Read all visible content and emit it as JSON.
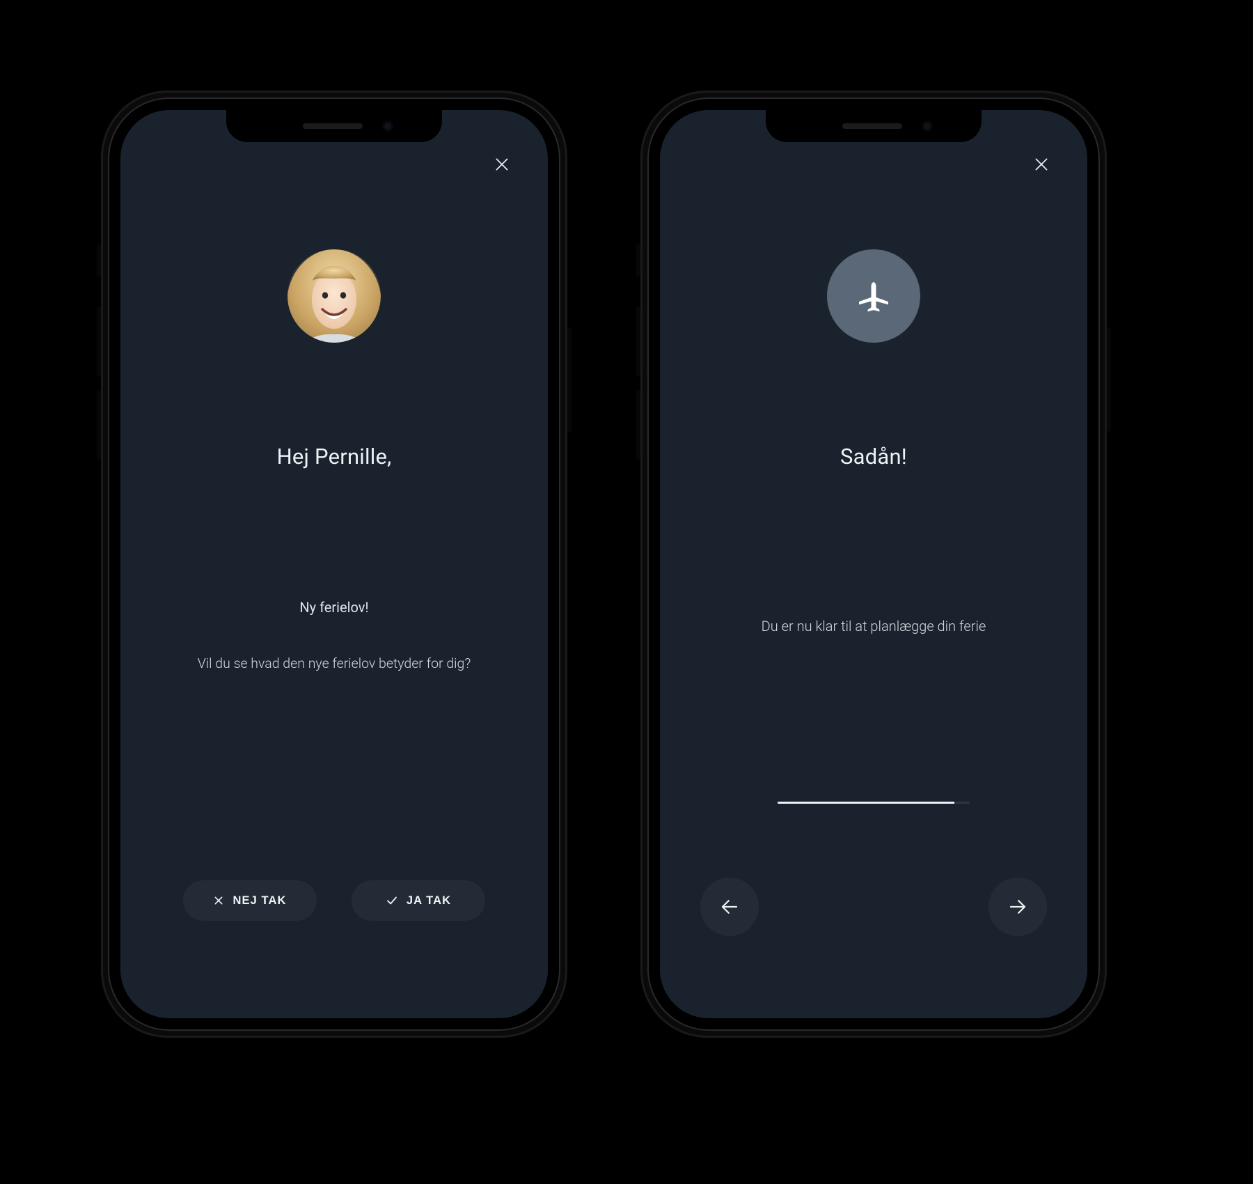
{
  "colors": {
    "screen_bg": "#1a232d",
    "pill_bg": "#232c36",
    "icon_circle_bg": "#5b6877",
    "text_primary": "#eef2f5",
    "text_secondary": "#d2d8de"
  },
  "screens": {
    "intro": {
      "heading": "Hej Pernille,",
      "line1": "Ny ferielov!",
      "line2": "Vil du se hvad den nye ferielov betyder for dig?",
      "buttons": {
        "decline": "NEJ TAK",
        "accept": "JA TAK"
      }
    },
    "done": {
      "heading": "Sadån!",
      "body": "Du er nu klar til at planlægge din ferie",
      "progress_percent": 92
    }
  }
}
